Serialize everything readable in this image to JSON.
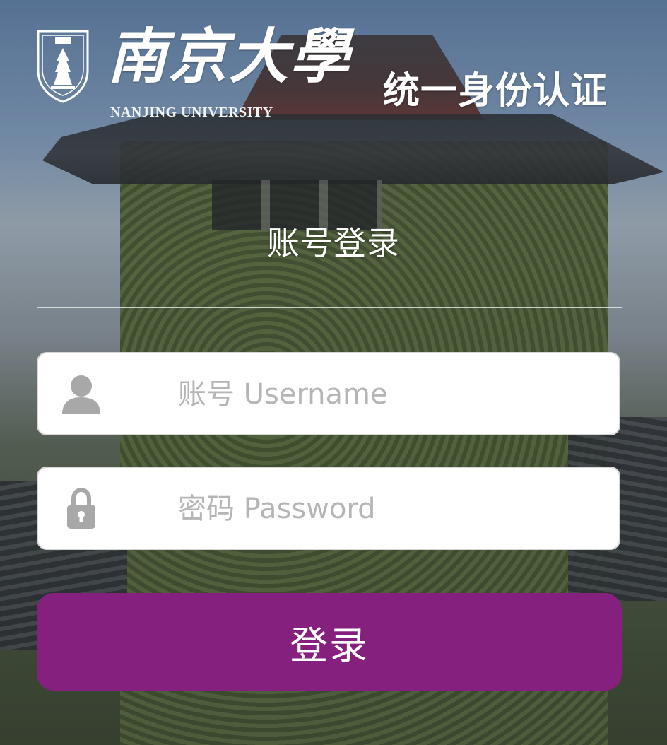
{
  "header": {
    "brand_cn": "南京大學",
    "brand_en": "NANJING UNIVERSITY",
    "title": "统一身份认证"
  },
  "login": {
    "heading": "账号登录",
    "username": {
      "value": "",
      "placeholder": "账号 Username",
      "icon": "user-icon"
    },
    "password": {
      "value": "",
      "placeholder": "密码 Password",
      "icon": "lock-icon"
    },
    "submit_label": "登录"
  },
  "colors": {
    "accent": "#86207f",
    "field_border": "#d6d6d6",
    "icon": "#a8a8a8",
    "placeholder": "#b5b5b5"
  }
}
